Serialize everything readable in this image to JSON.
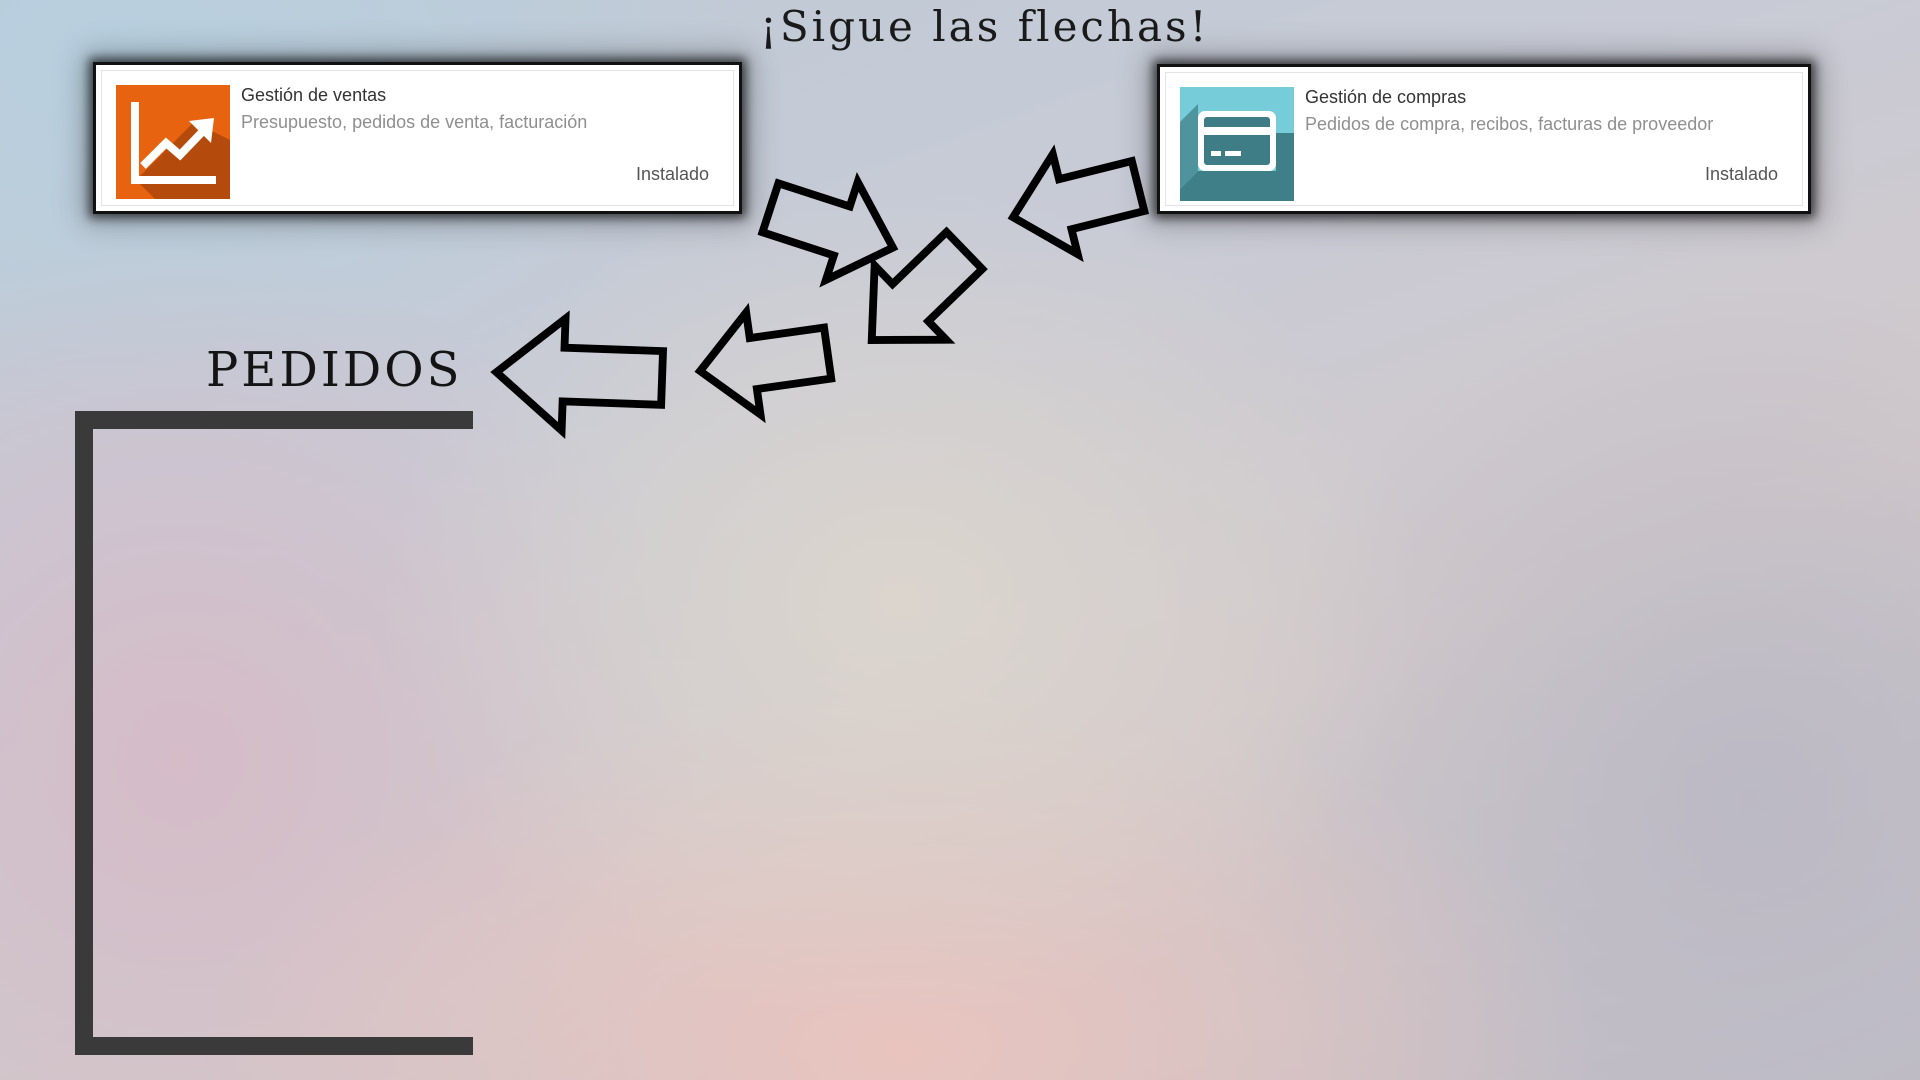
{
  "headline": "¡Sigue las flechas!",
  "apps": [
    {
      "name": "Gestión de ventas",
      "description": "Presupuesto, pedidos de venta, facturación",
      "status": "Instalado",
      "icon": "sales-trend-chart-icon",
      "icon_color": "#e8630f"
    },
    {
      "name": "Gestión de compras",
      "description": "Pedidos de compra, recibos, facturas de proveedor",
      "status": "Instalado",
      "icon": "credit-card-icon",
      "icon_color": "#76ccd9"
    }
  ],
  "section": {
    "title": "PEDIDOS"
  }
}
